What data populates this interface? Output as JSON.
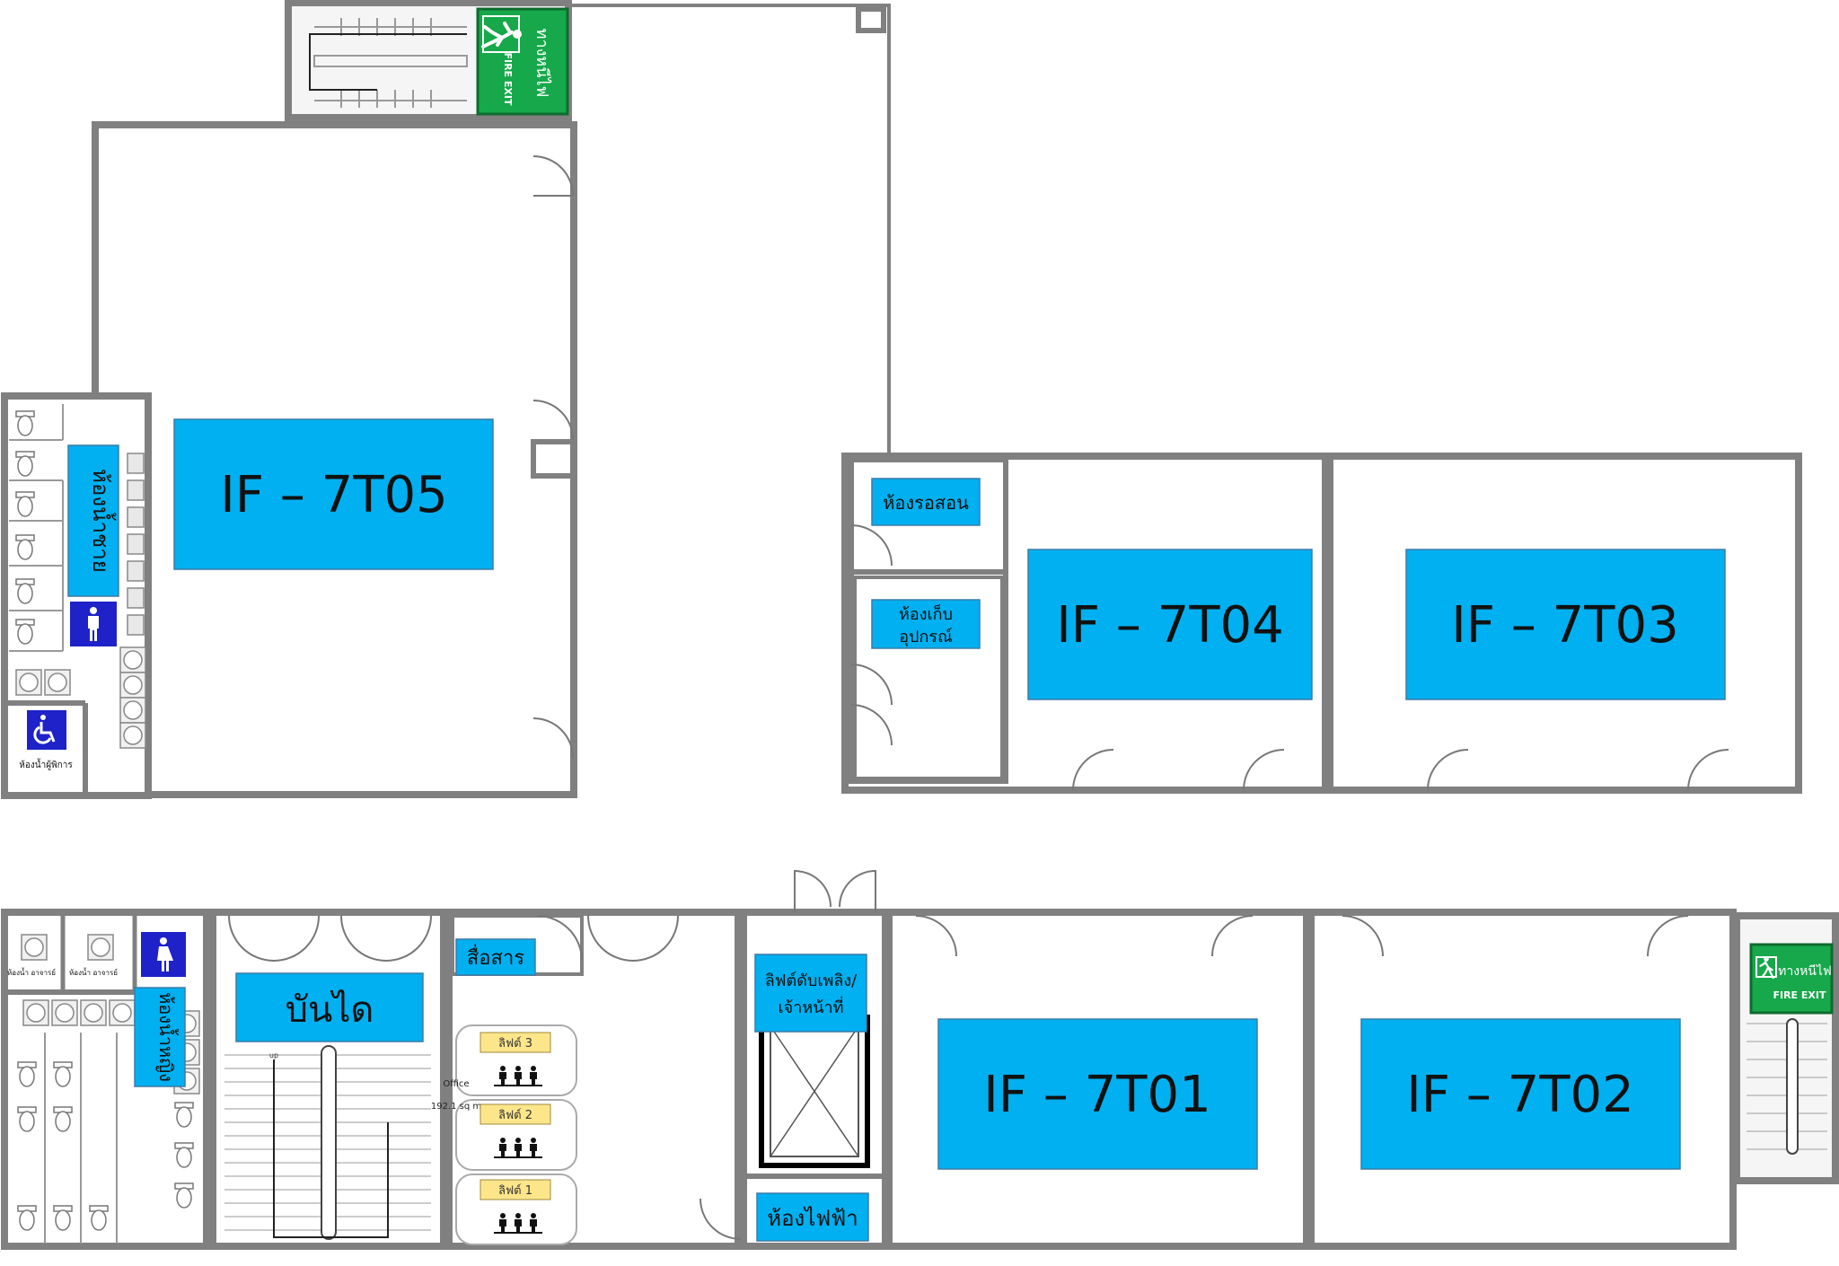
{
  "colors": {
    "wall": "#808080",
    "wall_fill": "#d9d9d9",
    "room_label": "#00b0f0",
    "fire_green": "#16a84a",
    "sign_blue": "#1e22c8",
    "lift_tag": "#fde68a"
  },
  "rooms": {
    "tf05": "IF – 7T05",
    "tf04": "IF – 7T04",
    "tf03": "IF – 7T03",
    "tf01": "IF – 7T01",
    "tf02": "IF – 7T02",
    "mens_toilet": "ห้องน้ำชาย",
    "womens_toilet": "ห้องน้ำหญิง",
    "waiting_room": "ห้องรอสอน",
    "storage_line1": "ห้องเก็บ",
    "storage_line2": "อุปกรณ์",
    "stairs": "บันได",
    "media": "สื่อสาร",
    "fire_lift_line1": "ลิฟต์ดับเพลิง/",
    "fire_lift_line2": "เจ้าหน้าที่",
    "electrical_room": "ห้องไฟฟ้า",
    "accessible_toilet": "ห้องน้ำผู้พิการ",
    "teacher_toilet_1": "ห้องน้ำ อาจารย์",
    "teacher_toilet_2": "ห้องน้ำ อาจารย์"
  },
  "lifts": [
    "ลิฟต์ 3",
    "ลิฟต์ 2",
    "ลิฟต์ 1"
  ],
  "office_note": {
    "line1": "Office",
    "line2": "192.1 sq m"
  },
  "stairs_marker": "up",
  "fire_exit": {
    "thai": "ทางหนีไฟ",
    "english": "FIRE EXIT"
  },
  "icons": [
    "male-icon",
    "female-icon",
    "wheelchair-icon",
    "running-man-icon",
    "people-icon",
    "elevator-shaft-icon"
  ]
}
